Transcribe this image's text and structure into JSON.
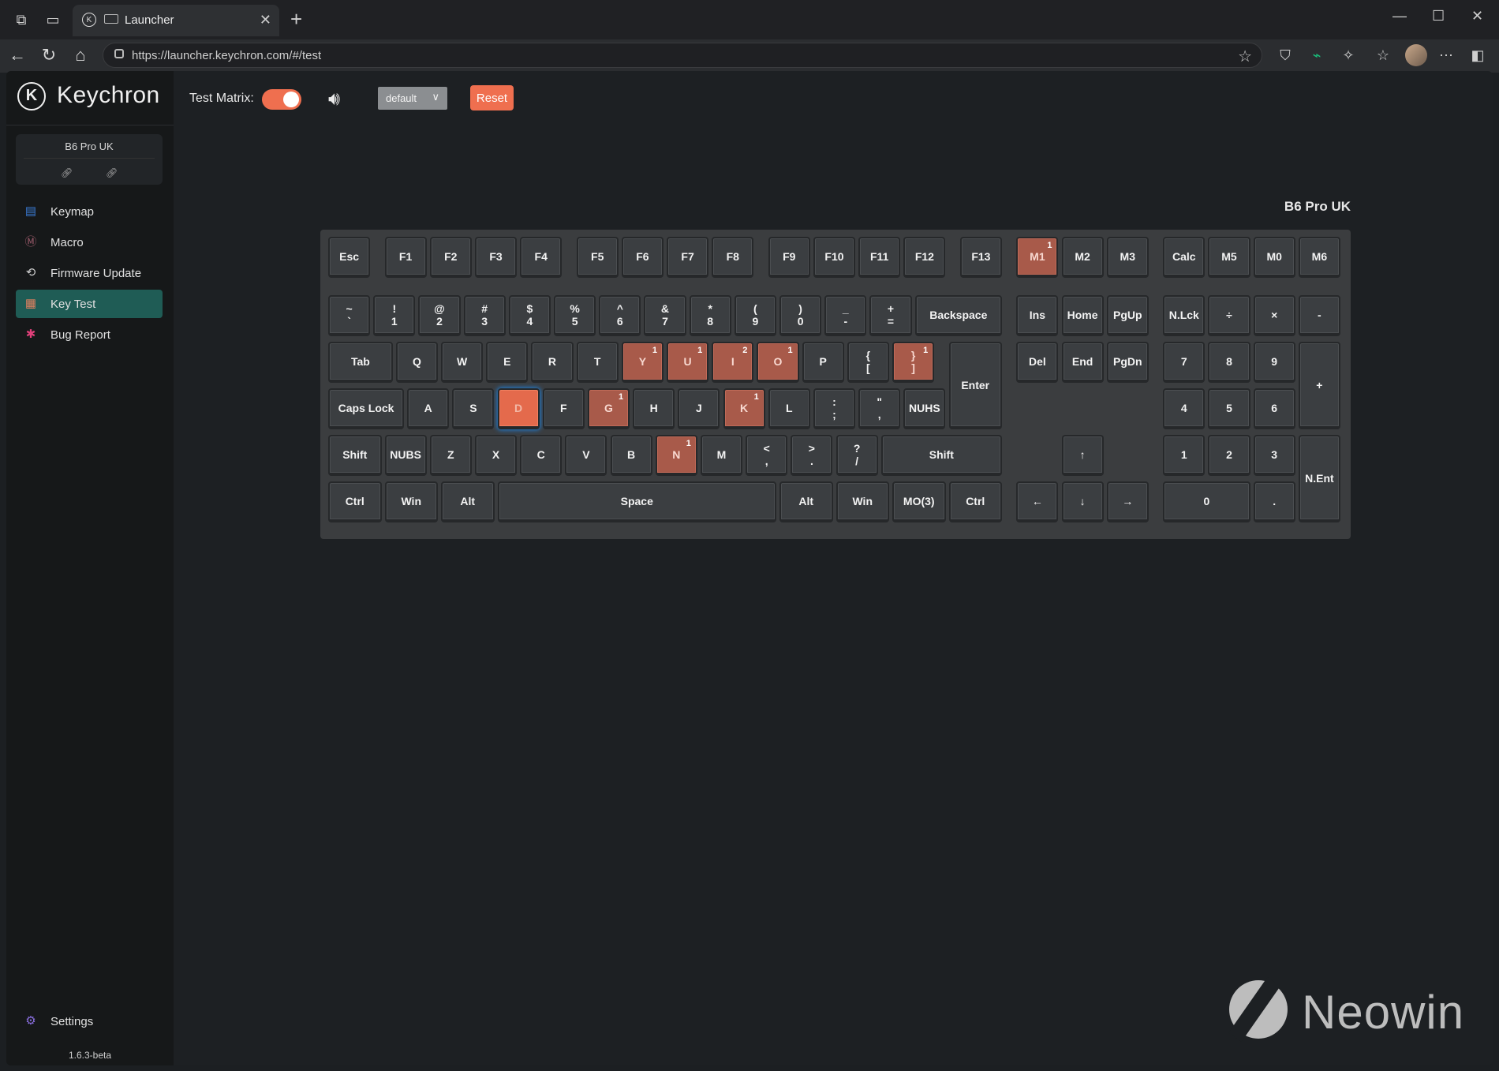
{
  "browser": {
    "tab_title": "Launcher",
    "url": "https://launcher.keychron.com/#/test",
    "icons": [
      "workspaces-icon",
      "tab-actions-icon",
      "back-icon",
      "refresh-icon",
      "home-icon",
      "lock-icon",
      "favorite-star-icon",
      "extension-shield-icon",
      "extension-chart-icon",
      "extensions-icon",
      "favorites-icon",
      "profile-avatar",
      "more-icon",
      "sidebar-icon"
    ]
  },
  "sidebar": {
    "logo_text": "Keychron",
    "device_name": "B6 Pro UK",
    "items": [
      {
        "label": "Keymap",
        "icon": "keymap-icon",
        "color": "#3a7bd5"
      },
      {
        "label": "Macro",
        "icon": "macro-icon",
        "color": "#9a5a6a"
      },
      {
        "label": "Firmware Update",
        "icon": "firmware-update-icon",
        "color": "#cfcfcf"
      },
      {
        "label": "Key Test",
        "icon": "key-test-icon",
        "color": "#e08060",
        "active": true
      },
      {
        "label": "Bug Report",
        "icon": "bug-icon",
        "color": "#e0407a"
      }
    ],
    "settings_label": "Settings",
    "version": "1.6.3-beta"
  },
  "toolbar": {
    "test_matrix_label": "Test Matrix:",
    "test_matrix_on": true,
    "select_value": "default",
    "reset_label": "Reset"
  },
  "keyboard": {
    "title": "B6 Pro UK",
    "accent": "#ef6f4f",
    "rows": [
      [
        {
          "l": "Esc"
        },
        {
          "l": "F1"
        },
        {
          "l": "F2"
        },
        {
          "l": "F3"
        },
        {
          "l": "F4"
        },
        {
          "l": "F5"
        },
        {
          "l": "F6"
        },
        {
          "l": "F7"
        },
        {
          "l": "F8"
        },
        {
          "l": "F9"
        },
        {
          "l": "F10"
        },
        {
          "l": "F11"
        },
        {
          "l": "F12"
        },
        {
          "l": "F13"
        },
        {
          "l": "M1",
          "s": "pressed",
          "c": "1"
        },
        {
          "l": "M2"
        },
        {
          "l": "M3"
        },
        {
          "l": "Calc"
        },
        {
          "l": "M5"
        },
        {
          "l": "M0"
        },
        {
          "l": "M6"
        }
      ],
      [
        {
          "t": "~",
          "b": "`"
        },
        {
          "t": "!",
          "b": "1"
        },
        {
          "t": "@",
          "b": "2"
        },
        {
          "t": "#",
          "b": "3"
        },
        {
          "t": "$",
          "b": "4"
        },
        {
          "t": "%",
          "b": "5"
        },
        {
          "t": "^",
          "b": "6"
        },
        {
          "t": "&",
          "b": "7"
        },
        {
          "t": "*",
          "b": "8"
        },
        {
          "t": "(",
          "b": "9"
        },
        {
          "t": ")",
          "b": "0"
        },
        {
          "t": "_",
          "b": "-"
        },
        {
          "t": "+",
          "b": "="
        },
        {
          "l": "Backspace"
        },
        {
          "l": "Ins"
        },
        {
          "l": "Home"
        },
        {
          "l": "PgUp"
        },
        {
          "l": "N.Lck"
        },
        {
          "l": "÷"
        },
        {
          "l": "×"
        },
        {
          "l": "-"
        }
      ],
      [
        {
          "l": "Tab"
        },
        {
          "l": "Q"
        },
        {
          "l": "W"
        },
        {
          "l": "E"
        },
        {
          "l": "R"
        },
        {
          "l": "T"
        },
        {
          "l": "Y",
          "s": "pressed",
          "c": "1"
        },
        {
          "l": "U",
          "s": "pressed",
          "c": "1"
        },
        {
          "l": "I",
          "s": "pressed",
          "c": "2"
        },
        {
          "l": "O",
          "s": "pressed",
          "c": "1"
        },
        {
          "l": "P"
        },
        {
          "t": "{",
          "b": "["
        },
        {
          "t": "}",
          "b": "]",
          "s": "pressed",
          "c": "1"
        },
        {
          "l": "Enter"
        },
        {
          "l": "Del"
        },
        {
          "l": "End"
        },
        {
          "l": "PgDn"
        },
        {
          "l": "7"
        },
        {
          "l": "8"
        },
        {
          "l": "9"
        },
        {
          "l": "+"
        }
      ],
      [
        {
          "l": "Caps Lock"
        },
        {
          "l": "A"
        },
        {
          "l": "S"
        },
        {
          "l": "D",
          "s": "active"
        },
        {
          "l": "F"
        },
        {
          "l": "G",
          "s": "pressed",
          "c": "1"
        },
        {
          "l": "H"
        },
        {
          "l": "J"
        },
        {
          "l": "K",
          "s": "pressed",
          "c": "1"
        },
        {
          "l": "L"
        },
        {
          "t": ":",
          "b": ";"
        },
        {
          "t": "\"",
          "b": ","
        },
        {
          "l": "NUHS"
        },
        {
          "l": "4"
        },
        {
          "l": "5"
        },
        {
          "l": "6"
        }
      ],
      [
        {
          "l": "Shift"
        },
        {
          "l": "NUBS"
        },
        {
          "l": "Z"
        },
        {
          "l": "X"
        },
        {
          "l": "C"
        },
        {
          "l": "V"
        },
        {
          "l": "B"
        },
        {
          "l": "N",
          "s": "pressed",
          "c": "1"
        },
        {
          "l": "M"
        },
        {
          "t": "<",
          "b": ","
        },
        {
          "t": ">",
          "b": "."
        },
        {
          "t": "?",
          "b": "/"
        },
        {
          "l": "Shift"
        },
        {
          "l": "↑"
        },
        {
          "l": "1"
        },
        {
          "l": "2"
        },
        {
          "l": "3"
        },
        {
          "l": "N.Ent"
        }
      ],
      [
        {
          "l": "Ctrl"
        },
        {
          "l": "Win"
        },
        {
          "l": "Alt"
        },
        {
          "l": "Space"
        },
        {
          "l": "Alt"
        },
        {
          "l": "Win"
        },
        {
          "l": "MO(3)"
        },
        {
          "l": "Ctrl"
        },
        {
          "l": "←"
        },
        {
          "l": "↓"
        },
        {
          "l": "→"
        },
        {
          "l": "0"
        },
        {
          "l": "."
        }
      ]
    ]
  },
  "watermark": {
    "text": "Neowin"
  }
}
